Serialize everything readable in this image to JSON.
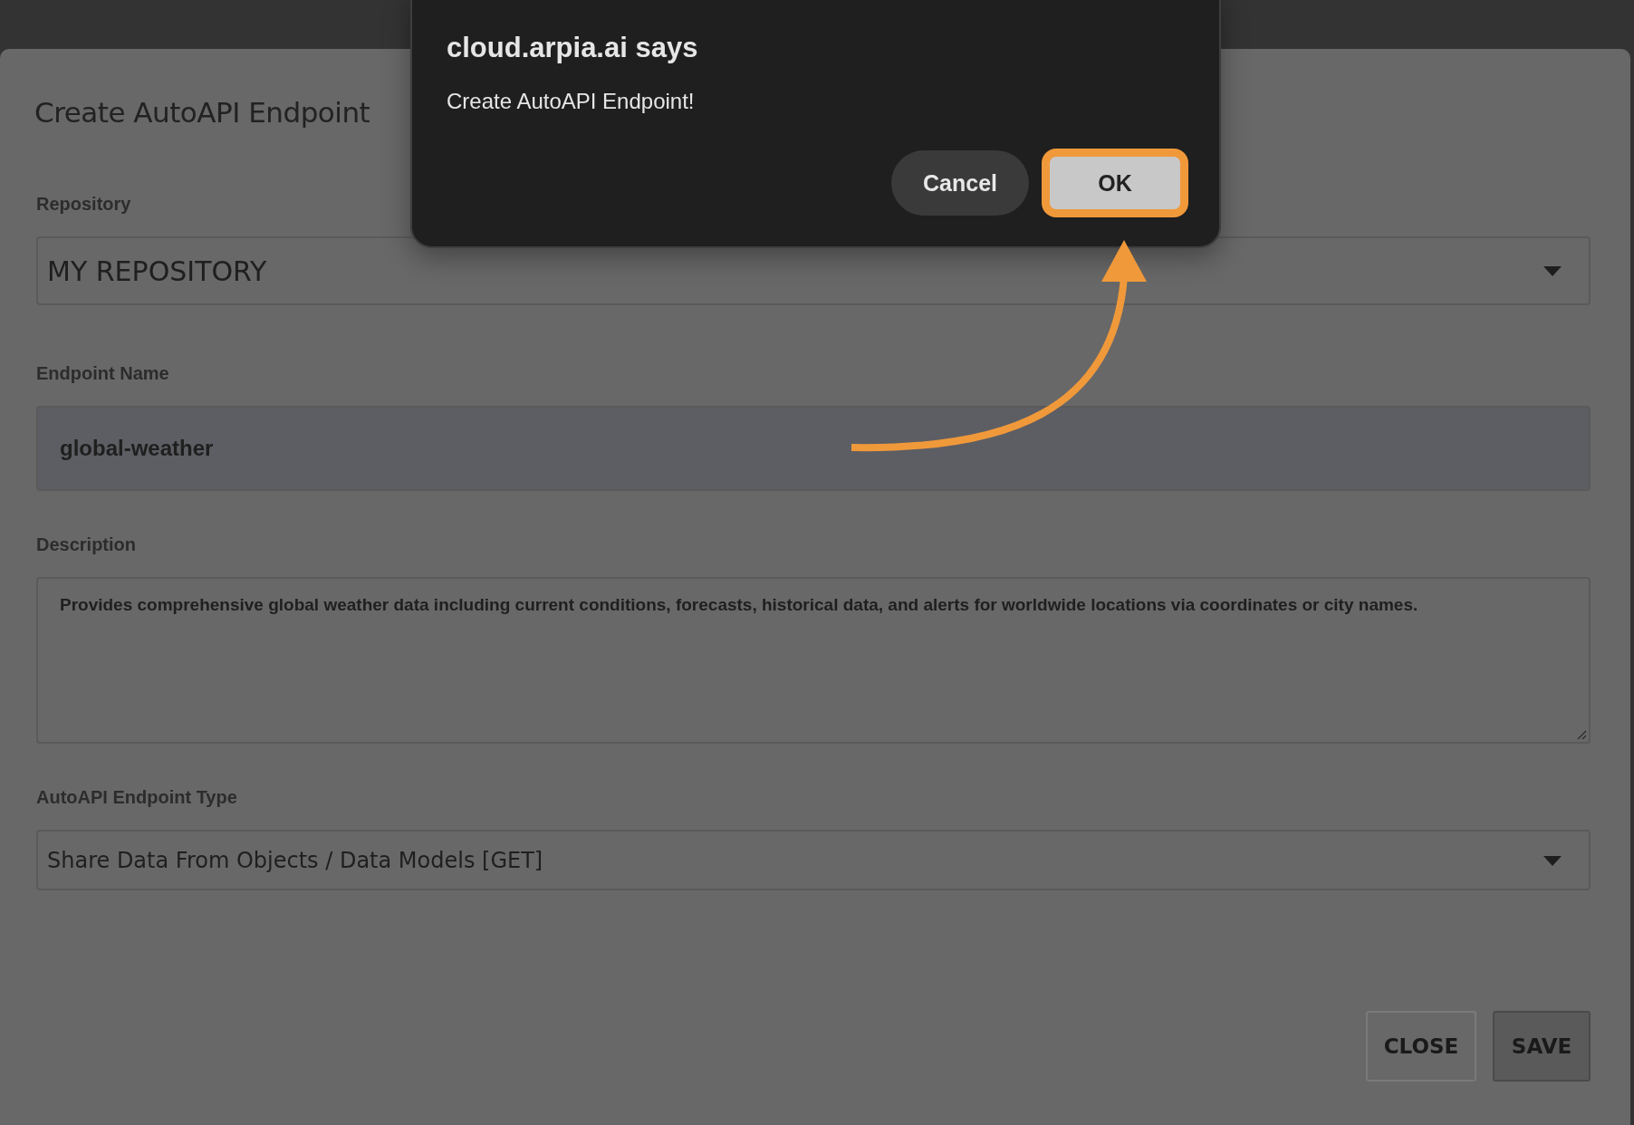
{
  "form": {
    "title": "Create AutoAPI Endpoint",
    "fields": [
      {
        "kind": "select",
        "label": "Repository",
        "value": "MY REPOSITORY"
      },
      {
        "kind": "input",
        "label": "Endpoint Name",
        "value": "global-weather"
      },
      {
        "kind": "textarea",
        "label": "Description",
        "value": "Provides comprehensive global weather data including current conditions, forecasts, historical data, and alerts for worldwide locations via coordinates or city names."
      },
      {
        "kind": "select",
        "label": "AutoAPI Endpoint Type",
        "value": "Share Data From Objects / Data Models [GET]"
      }
    ],
    "buttons": [
      {
        "label": "CLOSE",
        "kind": "outline"
      },
      {
        "label": "SAVE",
        "kind": "filled"
      }
    ]
  },
  "dialog": {
    "title": "cloud.arpia.ai says",
    "message": "Create AutoAPI Endpoint!",
    "buttons": [
      {
        "label": "Cancel",
        "highlighted": false
      },
      {
        "label": "OK",
        "highlighted": true
      }
    ]
  }
}
